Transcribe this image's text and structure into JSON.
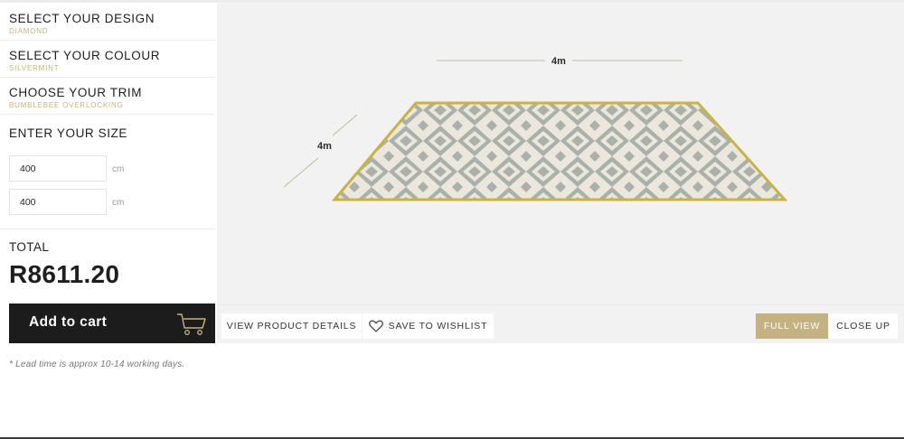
{
  "options": [
    {
      "title": "SELECT YOUR DESIGN",
      "value": "DIAMOND"
    },
    {
      "title": "SELECT YOUR COLOUR",
      "value": "SILVERMINT"
    },
    {
      "title": "CHOOSE YOUR TRIM",
      "value": "BUMBLEBEE OVERLOCKING"
    }
  ],
  "size": {
    "title": "ENTER YOUR SIZE",
    "width_value": "400",
    "length_value": "400",
    "unit": "cm"
  },
  "total": {
    "label": "TOTAL",
    "value": "R8611.20"
  },
  "cart": {
    "label": "Add to cart",
    "icon": "cart-icon"
  },
  "lead_time": "* Lead time is approx 10-14 working days.",
  "preview": {
    "width_dim": "4m",
    "depth_dim": "4m",
    "colors": {
      "rug_base": "#ebe7dd",
      "pattern": "#a9b1aa",
      "trim": "#c9b347",
      "dim_line": "#b8c0a2"
    }
  },
  "toolbar": {
    "details": "VIEW PRODUCT DETAILS",
    "wishlist": "SAVE TO WISHLIST",
    "wishlist_icon": "heart-icon",
    "full_view": "FULL VIEW",
    "close_up": "CLOSE UP"
  },
  "colors": {
    "accent": "#c4b282",
    "dark": "#1c1c1c"
  }
}
